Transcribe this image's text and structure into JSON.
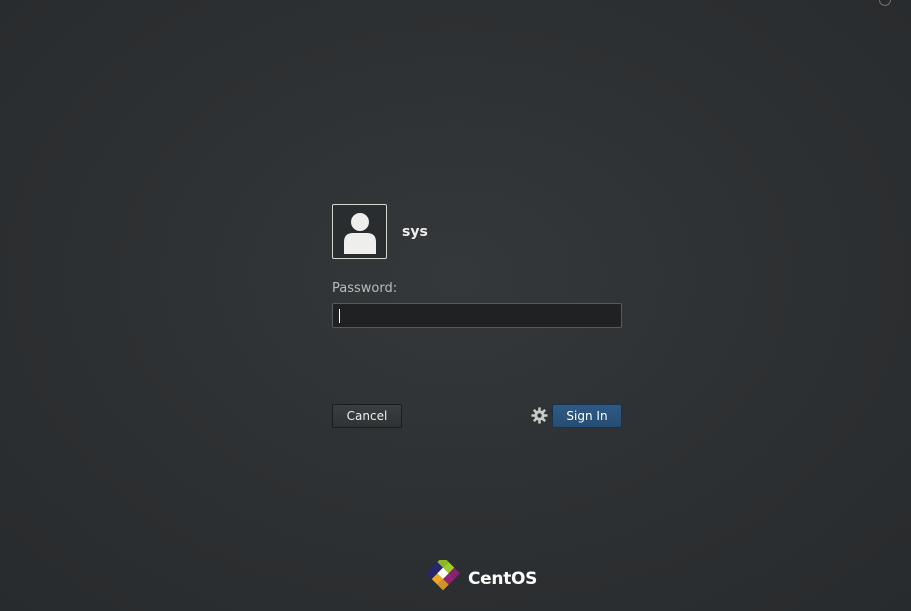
{
  "login": {
    "username": "sys",
    "password_label": "Password:",
    "password_value": "",
    "cancel_label": "Cancel",
    "signin_label": "Sign In"
  },
  "branding": {
    "logo_text": "CentOS"
  },
  "icons": {
    "avatar": "user-silhouette-icon",
    "session": "gear-icon",
    "logo": "centos-logo-icon"
  },
  "colors": {
    "background": "#2e3133",
    "signin_button": "#2a5379",
    "text": "#eeeeec"
  }
}
